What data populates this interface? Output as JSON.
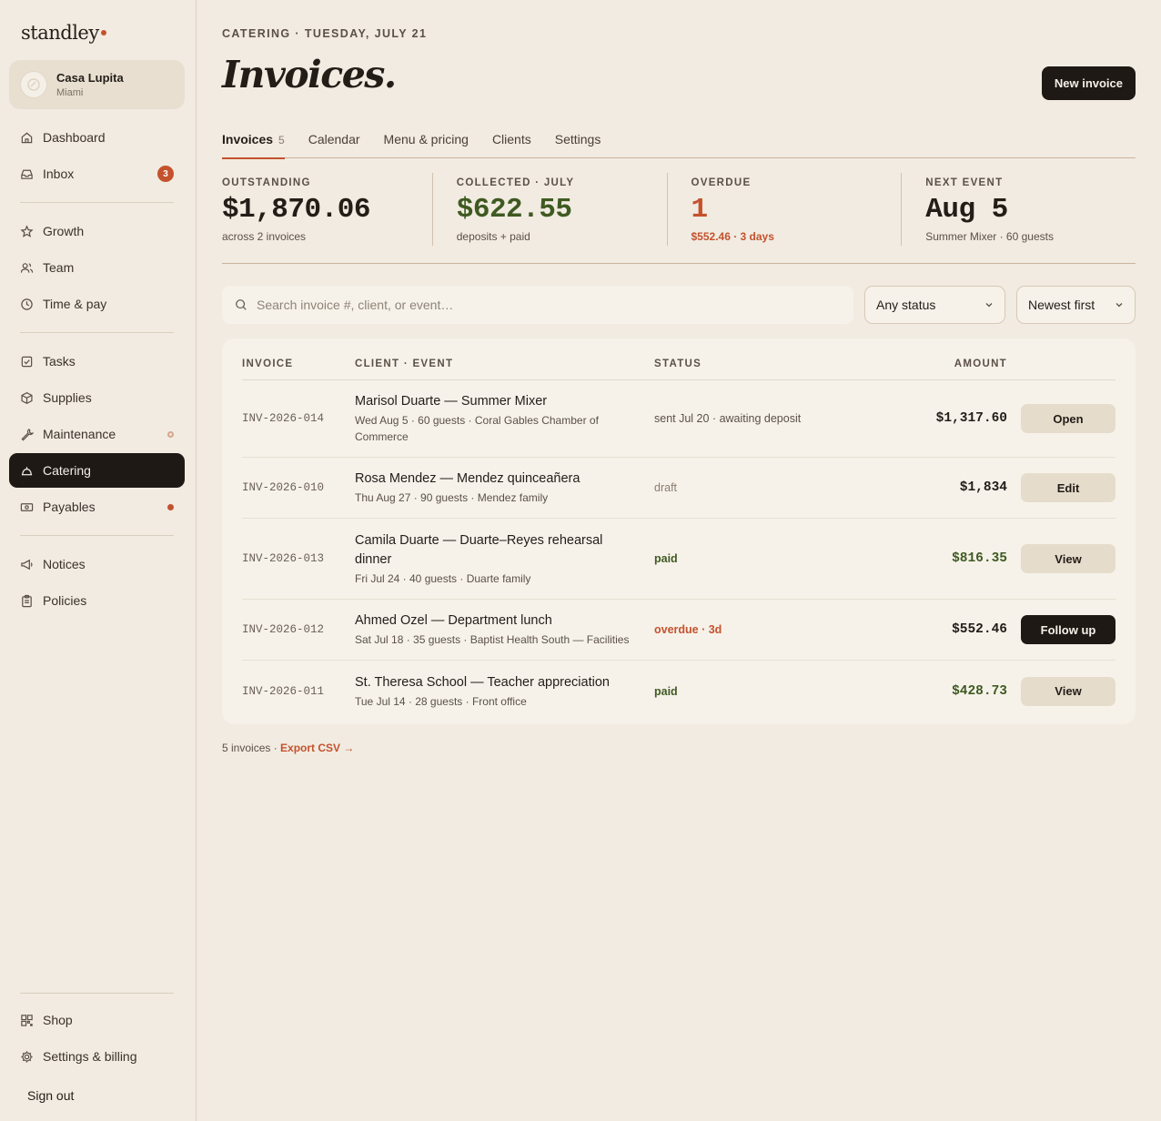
{
  "app": {
    "logo": "standley"
  },
  "org": {
    "name": "Casa Lupita",
    "city": "Miami"
  },
  "sidebar": {
    "group1": [
      {
        "label": "Dashboard",
        "icon": "home-icon"
      },
      {
        "label": "Inbox",
        "icon": "inbox-icon",
        "badge": "3"
      }
    ],
    "group2": [
      {
        "label": "Growth",
        "icon": "star-icon"
      },
      {
        "label": "Team",
        "icon": "users-icon"
      },
      {
        "label": "Time & pay",
        "icon": "clock-icon"
      }
    ],
    "group3": [
      {
        "label": "Tasks",
        "icon": "checkbox-icon"
      },
      {
        "label": "Supplies",
        "icon": "box-icon"
      },
      {
        "label": "Maintenance",
        "icon": "wrench-icon"
      },
      {
        "label": "Catering",
        "icon": "cloche-icon"
      },
      {
        "label": "Payables",
        "icon": "banknote-icon"
      }
    ],
    "group4": [
      {
        "label": "Notices",
        "icon": "megaphone-icon"
      },
      {
        "label": "Policies",
        "icon": "clipboard-icon"
      }
    ],
    "bottom": [
      {
        "label": "Shop",
        "icon": "grid-icon"
      },
      {
        "label": "Settings & billing",
        "icon": "gear-icon"
      }
    ],
    "signout": "Sign out"
  },
  "header": {
    "eyebrow": "CATERING · TUESDAY, JULY 21",
    "title": "Invoices.",
    "new_button": "New invoice"
  },
  "tabs": [
    {
      "label": "Invoices",
      "count": "5"
    },
    {
      "label": "Calendar"
    },
    {
      "label": "Menu & pricing"
    },
    {
      "label": "Clients"
    },
    {
      "label": "Settings"
    }
  ],
  "stats": [
    {
      "label": "OUTSTANDING",
      "value": "$1,870.06",
      "sub": "across 2 invoices"
    },
    {
      "label": "COLLECTED · JULY",
      "value": "$622.55",
      "sub": "deposits + paid"
    },
    {
      "label": "OVERDUE",
      "value": "1",
      "sub": "$552.46 · 3 days"
    },
    {
      "label": "NEXT EVENT",
      "value": "Aug 5",
      "sub": "Summer Mixer · 60 guests"
    }
  ],
  "filters": {
    "search_placeholder": "Search invoice #, client, or event…",
    "status": "Any status",
    "sort": "Newest first"
  },
  "table": {
    "headers": [
      "INVOICE",
      "CLIENT · EVENT",
      "STATUS",
      "AMOUNT"
    ],
    "rows": [
      {
        "invoice": "INV-2026-014",
        "title": "Marisol Duarte — Summer Mixer",
        "sub": "Wed Aug 5 · 60 guests · Coral Gables Chamber of Commerce",
        "status": "sent Jul 20 · awaiting deposit",
        "amount": "$1,317.60",
        "action": "Open"
      },
      {
        "invoice": "INV-2026-010",
        "title": "Rosa Mendez — Mendez quinceañera",
        "sub": "Thu Aug 27 · 90 guests · Mendez family",
        "status": "draft",
        "amount": "$1,834",
        "action": "Edit"
      },
      {
        "invoice": "INV-2026-013",
        "title": "Camila Duarte — Duarte–Reyes rehearsal dinner",
        "sub": "Fri Jul 24 · 40 guests · Duarte family",
        "status": "paid",
        "amount": "$816.35",
        "action": "View"
      },
      {
        "invoice": "INV-2026-012",
        "title": "Ahmed Ozel — Department lunch",
        "sub": "Sat Jul 18 · 35 guests · Baptist Health South — Facilities",
        "status": "overdue · 3d",
        "amount": "$552.46",
        "action": "Follow up"
      },
      {
        "invoice": "INV-2026-011",
        "title": "St. Theresa School — Teacher appreciation",
        "sub": "Tue Jul 14 · 28 guests · Front office",
        "status": "paid",
        "amount": "$428.73",
        "action": "View"
      }
    ]
  },
  "footer": {
    "count": "5 invoices · ",
    "export": "Export CSV →"
  },
  "colors": {
    "accent": "#c4522d",
    "dark": "#1e1915",
    "green": "#3f5a21",
    "background": "#f1ebe1"
  }
}
